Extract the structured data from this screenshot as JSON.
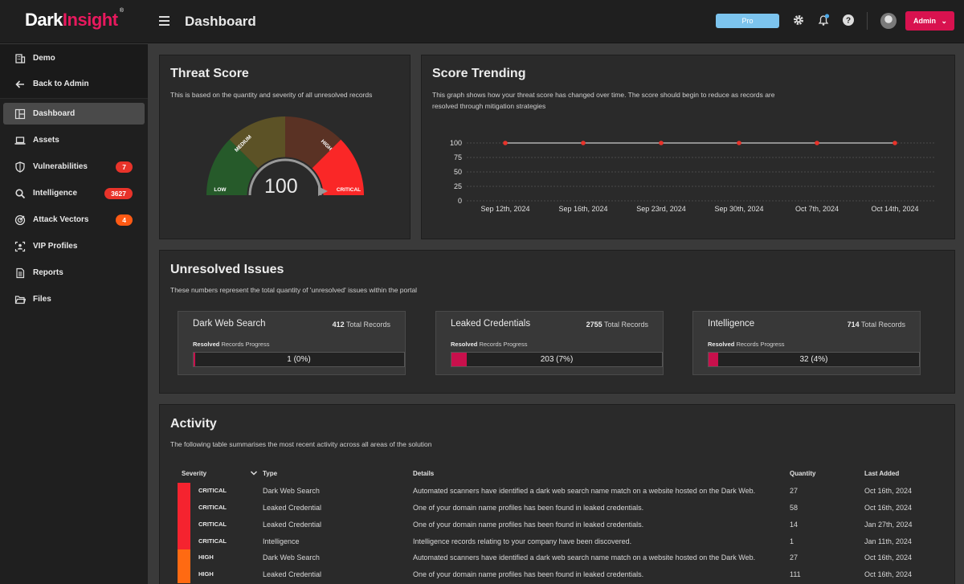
{
  "app": {
    "logo_dark": "Dark",
    "logo_insight": "Insight",
    "logo_reg": "®",
    "page_title": "Dashboard",
    "pro_label": "Pro",
    "admin_label": "Admin",
    "admin_chevron": "⌄"
  },
  "sidebar": {
    "top_items": [
      {
        "label": "Demo",
        "icon": "building-icon"
      },
      {
        "label": "Back to Admin",
        "icon": "arrow-left-icon"
      }
    ],
    "items": [
      {
        "label": "Dashboard",
        "icon": "dashboard-icon",
        "active": true
      },
      {
        "label": "Assets",
        "icon": "laptop-icon"
      },
      {
        "label": "Vulnerabilities",
        "icon": "shield-icon",
        "badge": "7",
        "badge_color": "#e8332a"
      },
      {
        "label": "Intelligence",
        "icon": "search-icon",
        "badge": "3627",
        "badge_color": "#e8332a"
      },
      {
        "label": "Attack Vectors",
        "icon": "radar-icon",
        "badge": "4",
        "badge_color": "#ff5a14"
      },
      {
        "label": "VIP Profiles",
        "icon": "vip-icon"
      },
      {
        "label": "Reports",
        "icon": "report-icon"
      },
      {
        "label": "Files",
        "icon": "folder-icon"
      }
    ]
  },
  "threat_score": {
    "title": "Threat Score",
    "description": "This is based on the quantity and severity of all unresolved records",
    "value": "100",
    "segments": [
      "LOW",
      "MEDIUM",
      "HIGH",
      "CRITICAL"
    ]
  },
  "score_trending": {
    "title": "Score Trending",
    "description": "This graph shows how your threat score has changed over time. The score should begin to reduce as records are resolved through mitigation strategies"
  },
  "chart_data": {
    "type": "line",
    "categories": [
      "Sep 12th, 2024",
      "Sep 16th, 2024",
      "Sep 23rd, 2024",
      "Sep 30th, 2024",
      "Oct 7th, 2024",
      "Oct 14th, 2024"
    ],
    "values": [
      100,
      100,
      100,
      100,
      100,
      100
    ],
    "yticks": [
      "0",
      "25",
      "50",
      "75",
      "100"
    ],
    "ylim": [
      0,
      100
    ],
    "grid": true,
    "line_color": "#cccccc",
    "point_color": "#e8332a"
  },
  "unresolved": {
    "title": "Unresolved Issues",
    "description": "These numbers represent the total quantity of 'unresolved' issues within the portal",
    "resolved_bold": "Resolved",
    "resolved_rest": " Records Progress",
    "total_suffix": " Total Records",
    "cards": [
      {
        "title": "Dark Web Search",
        "total": "412",
        "progress_text": "1 (0%)",
        "progress": 0.0024
      },
      {
        "title": "Leaked Credentials",
        "total": "2755",
        "progress_text": "203 (7%)",
        "progress": 0.074
      },
      {
        "title": "Intelligence",
        "total": "714",
        "progress_text": "32 (4%)",
        "progress": 0.045
      }
    ]
  },
  "activity": {
    "title": "Activity",
    "description": "The following table summarises the most recent activity across all areas of the solution",
    "headers": {
      "severity": "Severity",
      "type": "Type",
      "details": "Details",
      "quantity": "Quantity",
      "last_added": "Last Added"
    },
    "sort_icon": "chevron-down-icon",
    "rows": [
      {
        "severity": "CRITICAL",
        "color": "#f5232f",
        "type": "Dark Web Search",
        "details": "Automated scanners have identified a dark web search name match on a website hosted on the Dark Web.",
        "quantity": "27",
        "date": "Oct 16th, 2024"
      },
      {
        "severity": "CRITICAL",
        "color": "#f5232f",
        "type": "Leaked Credential",
        "details": "One of your domain name profiles has been found in leaked credentials.",
        "quantity": "58",
        "date": "Oct 16th, 2024"
      },
      {
        "severity": "CRITICAL",
        "color": "#f5232f",
        "type": "Leaked Credential",
        "details": "One of your domain name profiles has been found in leaked credentials.",
        "quantity": "14",
        "date": "Jan 27th, 2024"
      },
      {
        "severity": "CRITICAL",
        "color": "#f5232f",
        "type": "Intelligence",
        "details": "Intelligence records relating to your company have been discovered.",
        "quantity": "1",
        "date": "Jan 11th, 2024"
      },
      {
        "severity": "HIGH",
        "color": "#ff6a12",
        "type": "Dark Web Search",
        "details": "Automated scanners have identified a dark web search name match on a website hosted on the Dark Web.",
        "quantity": "27",
        "date": "Oct 16th, 2024"
      },
      {
        "severity": "HIGH",
        "color": "#ff6a12",
        "type": "Leaked Credential",
        "details": "One of your domain name profiles has been found in leaked credentials.",
        "quantity": "111",
        "date": "Oct 16th, 2024"
      }
    ]
  }
}
